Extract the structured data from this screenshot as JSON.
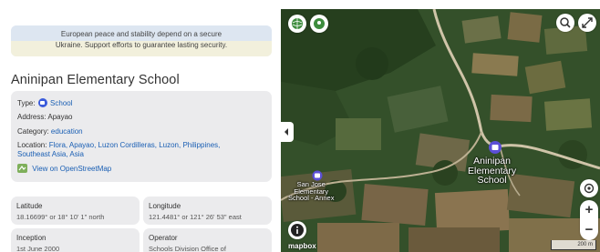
{
  "banner": {
    "line1": "European peace and stability depend on a secure",
    "line2": "Ukraine. Support efforts to guarantee lasting security."
  },
  "place": {
    "title": "Aninipan Elementary School",
    "type_label": "Type:",
    "type_value": "School",
    "address_label": "Address:",
    "address_value": "Apayao",
    "category_label": "Category:",
    "category_value": "education",
    "location_label": "Location:",
    "location_line1": "Flora, Apayao, Luzon Cordilleras, Luzon, Philippines,",
    "location_line2": "Southeast Asia, Asia",
    "osm_link": "View on OpenStreetMap"
  },
  "facts": {
    "latitude_label": "Latitude",
    "latitude_value": "18.16699° or 18° 10' 1\" north",
    "longitude_label": "Longitude",
    "longitude_value": "121.4481° or 121° 26' 53\" east",
    "inception_label": "Inception",
    "inception_value": "1st June 2000",
    "operator_label": "Operator",
    "operator_value": "Schools Division Office of"
  },
  "map": {
    "main_label_line1": "Aninipan",
    "main_label_line2": "Elementary",
    "main_label_line3": "School",
    "annex_line1": "San Jose",
    "annex_line2": "Elementary",
    "annex_line3": "School - Annex",
    "attribution": "mapbox",
    "scale_label": "200 m",
    "zoom_in": "+",
    "zoom_out": "−"
  },
  "colors": {
    "link": "#1a5fb4",
    "school_marker": "#5b4fd6",
    "panel_card": "#ebebed"
  },
  "icons": [
    "school-icon",
    "osm-icon",
    "wikipedia-icon",
    "location-pin-icon",
    "search-icon",
    "fullscreen-icon",
    "collapse-arrow-icon",
    "info-icon",
    "geolocate-icon"
  ]
}
